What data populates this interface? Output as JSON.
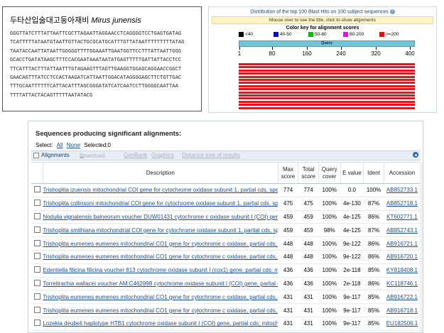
{
  "sequence": {
    "title_korean": "두타산입술대고둥아재비",
    "title_scientific": "Mirus junensis",
    "lines": [
      "GGGTTATCTTTATTAATTCGCTTAGAATTAGGAACCTCAGGGGTCCTGAGTGATAG",
      "TCATTTTTATAATGTAATTGTTACTGCGCATGCATTTGTTATAATTTTTTTTTATAG",
      "TAATACCAATTATAATTGGGGGTTTTGGAAATTGAATGGTTCCTTTATTAATTGGG",
      "GCACCTGATATAAGCTTTCCACGAATAAATAATATGAGTTTTTGATTATTACCTCC",
      "TTCATTTACTTTATTAATTTGTAGAAGTTTAGTTGAAGGTGGAGCAGGAACCGGCT",
      "GAACAGTTTATCCTCCACTAAGATCATTAATTGGACATAGGGGAGCTTCTGTTGAC",
      "TTTGCAATTTTTTCATTACATTTAGCGGGATATCATCAATCCTTGGGGCAATTAA",
      "TTTTATTACTACAGTTTTTAATATACG"
    ]
  },
  "blast_graphic": {
    "title": "Distribution of the top 100 Blast Hits on 100 subject sequences",
    "hint": "Mouse over to see the title, click to show alignments",
    "key_title": "Color key for alignment scores",
    "legend": [
      {
        "label": "<40",
        "color": "#000000"
      },
      {
        "label": "40-50",
        "color": "#0000ff"
      },
      {
        "label": "50-80",
        "color": "#00c000"
      },
      {
        "label": "80-200",
        "color": "#ff00ff"
      },
      {
        "label": ">=200",
        "color": "#ff0000"
      }
    ],
    "query_label": "Query",
    "ticks": [
      "1",
      "80",
      "160",
      "240",
      "320",
      "400"
    ],
    "hit_bar_color": "#e8131b",
    "hit_bar_count": 15
  },
  "results": {
    "heading": "Sequences producing significant alignments:",
    "select_label": "Select:",
    "select_all": "All",
    "select_none": "None",
    "selected_text": "Selected:0",
    "toolbar": {
      "alignments": "Alignments",
      "download": "Download",
      "genbank": "GenBank",
      "graphics": "Graphics",
      "distance_tree": "Distance tree of results"
    },
    "columns": {
      "description": "Description",
      "max_score": "Max score",
      "total_score": "Total score",
      "query_cover": "Query cover",
      "e_value": "E value",
      "ident": "Ident",
      "accession": "Accession"
    },
    "rows": [
      {
        "description": "Trishoplita izuensis mitochondrial COI gene for cytochrome oxidase subunit 1, partial cds, speci",
        "max": "774",
        "total": "774",
        "cover": "100%",
        "e": "0.0",
        "ident": "100%",
        "accession": "AB852733.1"
      },
      {
        "description": "Trishoplita collinsoni mitochondrial COI gene for cytochrome oxidase subunit 1, partial cds, spe",
        "max": "475",
        "total": "475",
        "cover": "100%",
        "e": "4e-130",
        "ident": "87%",
        "accession": "AB852718.1"
      },
      {
        "description": "Nodulia vignalensis balneorum voucher DUW01431 cytochrome c oxidase subunit I (COI) gene,",
        "max": "459",
        "total": "459",
        "cover": "100%",
        "e": "4e-125",
        "ident": "86%",
        "accession": "KT602771.1"
      },
      {
        "description": "Trishoplita smithiana mitochondrial COI gene for cytochrome oxidase subunit 1, partial cds, spe",
        "max": "459",
        "total": "459",
        "cover": "98%",
        "e": "4e-125",
        "ident": "87%",
        "accession": "AB852743.1"
      },
      {
        "description": "Trishoplita eumenes eumenes mitochondrial CO1 gene for cytochrome c oxidase, partial cds, is",
        "max": "448",
        "total": "448",
        "cover": "100%",
        "e": "9e-122",
        "ident": "86%",
        "accession": "AB916721.1"
      },
      {
        "description": "Trishoplita eumenes eumenes mitochondrial CO1 gene for cytochrome c oxidase, partial cds, is",
        "max": "448",
        "total": "448",
        "cover": "100%",
        "e": "9e-122",
        "ident": "86%",
        "accession": "AB916720.1"
      },
      {
        "description": "Edentiella filicina filicina voucher 813 cytochrome oxidase subunit I (cox1) gene, partial cds; mit",
        "max": "436",
        "total": "436",
        "cover": "100%",
        "e": "2e-118",
        "ident": "85%",
        "accession": "KY818408.1"
      },
      {
        "description": "Torreitrachia wallacei voucher AM:C462998 cytochrome oxidase subunit I (COI) gene, partial c",
        "max": "436",
        "total": "436",
        "cover": "100%",
        "e": "2e-118",
        "ident": "86%",
        "accession": "KC118746.1"
      },
      {
        "description": "Trishoplita eumenes eumenes mitochondrial CO1 gene for cytochrome c oxidase, partial cds, is",
        "max": "431",
        "total": "431",
        "cover": "100%",
        "e": "9e-117",
        "ident": "85%",
        "accession": "AB916722.1"
      },
      {
        "description": "Trishoplita eumenes eumenes mitochondrial CO1 gene for cytochrome c oxidase, partial cds, is",
        "max": "431",
        "total": "431",
        "cover": "100%",
        "e": "9e-117",
        "ident": "85%",
        "accession": "AB916718.1"
      },
      {
        "description": "Lozekia deubeli haplotype HTB1 cytochrome oxidase subunit I (COI) gene, partial cds; mitochor",
        "max": "431",
        "total": "431",
        "cover": "100%",
        "e": "9e-117",
        "ident": "85%",
        "accession": "EU182506.1"
      }
    ]
  }
}
